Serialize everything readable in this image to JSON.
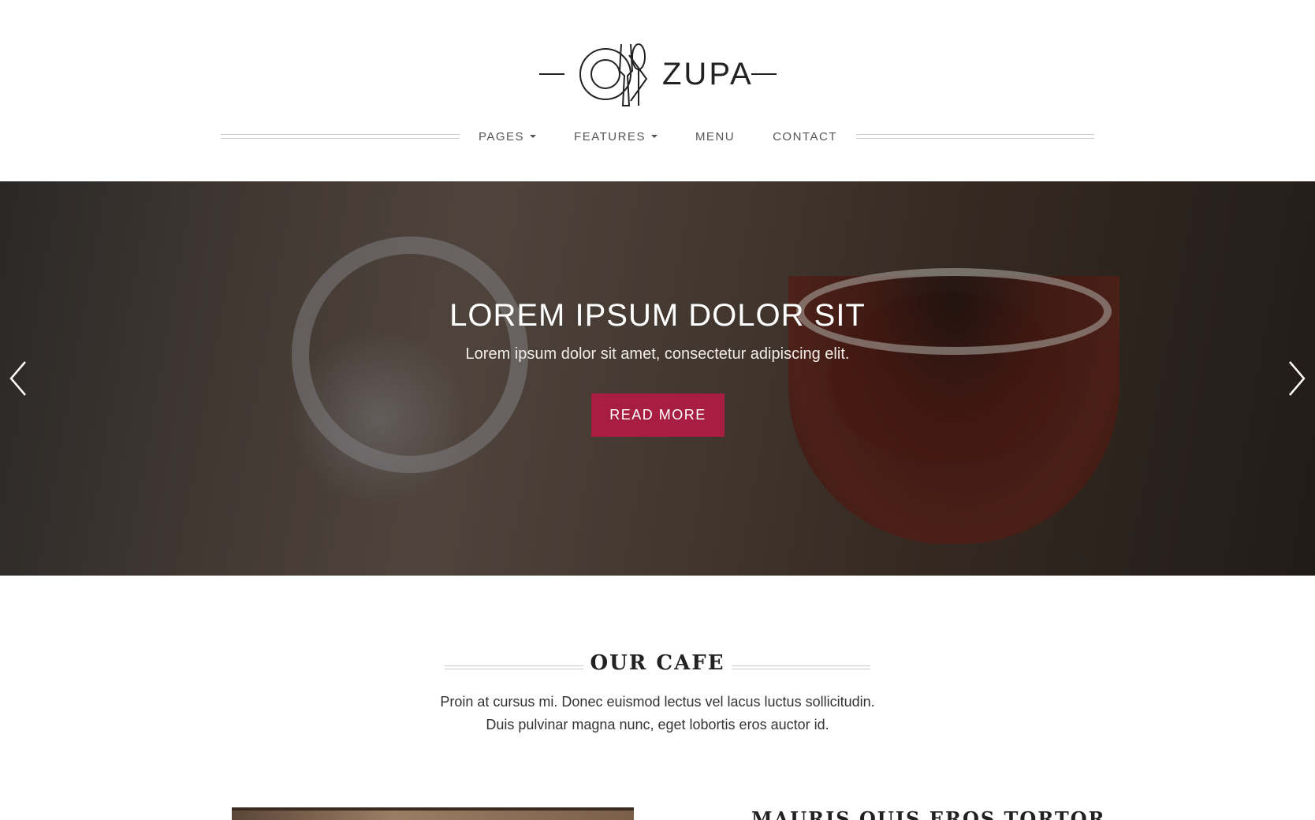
{
  "brand": {
    "name": "ZUPA",
    "logo_icon": "plate-fork-spoon-icon"
  },
  "nav": {
    "items": [
      {
        "label": "PAGES",
        "has_dropdown": true
      },
      {
        "label": "FEATURES",
        "has_dropdown": true
      },
      {
        "label": "MENU",
        "has_dropdown": false
      },
      {
        "label": "CONTACT",
        "has_dropdown": false
      }
    ]
  },
  "hero": {
    "title": "LOREM IPSUM DOLOR SIT",
    "subtitle": "Lorem ipsum dolor sit amet, consectetur adipiscing elit.",
    "button_label": "READ MORE",
    "prev_icon": "chevron-left-icon",
    "next_icon": "chevron-right-icon"
  },
  "cafe": {
    "title": "OUR CAFE",
    "text_line1": "Proin at cursus mi. Donec euismod lectus vel lacus luctus sollicitudin.",
    "text_line2": "Duis pulvinar magna nunc, eget lobortis eros auctor id.",
    "subheading": "MAURIS QUIS EROS TORTOR"
  },
  "colors": {
    "accent": "#a81e43",
    "text": "#333333",
    "rule": "#cccccc"
  }
}
